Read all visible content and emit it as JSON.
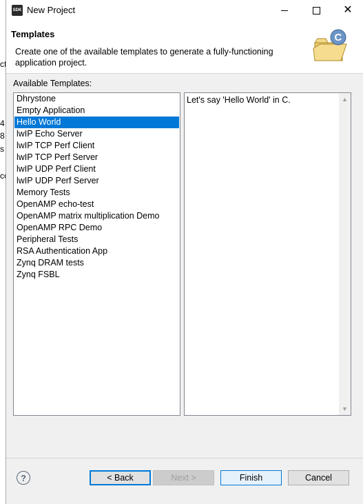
{
  "window": {
    "title": "New Project",
    "app_icon_text": "SDK"
  },
  "background_fragments": [
    "cf",
    "4",
    "8",
    "s",
    "co"
  ],
  "banner": {
    "title": "Templates",
    "description": "Create one of the available templates to generate a fully-functioning application project.",
    "icon": "c-project-folder-icon"
  },
  "templates": {
    "label": "Available Templates:",
    "items": [
      "Dhrystone",
      "Empty Application",
      "Hello World",
      "lwIP Echo Server",
      "lwIP TCP Perf Client",
      "lwIP TCP Perf Server",
      "lwIP UDP Perf Client",
      "lwIP UDP Perf Server",
      "Memory Tests",
      "OpenAMP echo-test",
      "OpenAMP matrix multiplication Demo",
      "OpenAMP RPC Demo",
      "Peripheral Tests",
      "RSA Authentication App",
      "Zynq DRAM tests",
      "Zynq FSBL"
    ],
    "selected": "Hello World"
  },
  "description_panel": {
    "text": "Let's say 'Hello World' in C."
  },
  "buttons": {
    "help": "?",
    "back": "< Back",
    "next": "Next >",
    "finish": "Finish",
    "cancel": "Cancel"
  },
  "colors": {
    "selection": "#0078d7",
    "banner_bg": "#ffffff",
    "dialog_bg": "#f0f0f0"
  }
}
